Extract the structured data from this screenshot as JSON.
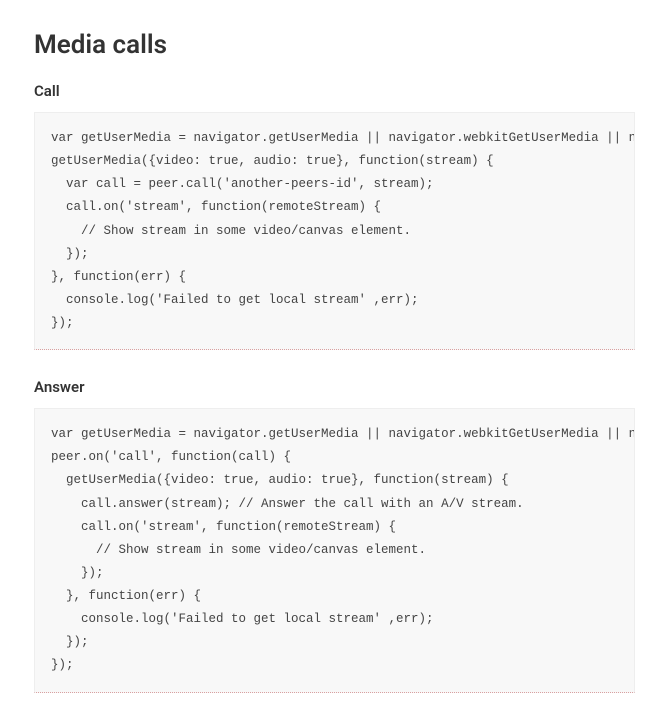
{
  "title": "Media calls",
  "sections": [
    {
      "heading": "Call",
      "code": "var getUserMedia = navigator.getUserMedia || navigator.webkitGetUserMedia || navigator.mozGetUserMedia;\ngetUserMedia({video: true, audio: true}, function(stream) {\n  var call = peer.call('another-peers-id', stream);\n  call.on('stream', function(remoteStream) {\n    // Show stream in some video/canvas element.\n  });\n}, function(err) {\n  console.log('Failed to get local stream' ,err);\n});"
    },
    {
      "heading": "Answer",
      "code": "var getUserMedia = navigator.getUserMedia || navigator.webkitGetUserMedia || navigator.mozGetUserMedia;\npeer.on('call', function(call) {\n  getUserMedia({video: true, audio: true}, function(stream) {\n    call.answer(stream); // Answer the call with an A/V stream.\n    call.on('stream', function(remoteStream) {\n      // Show stream in some video/canvas element.\n    });\n  }, function(err) {\n    console.log('Failed to get local stream' ,err);\n  });\n});"
    }
  ]
}
